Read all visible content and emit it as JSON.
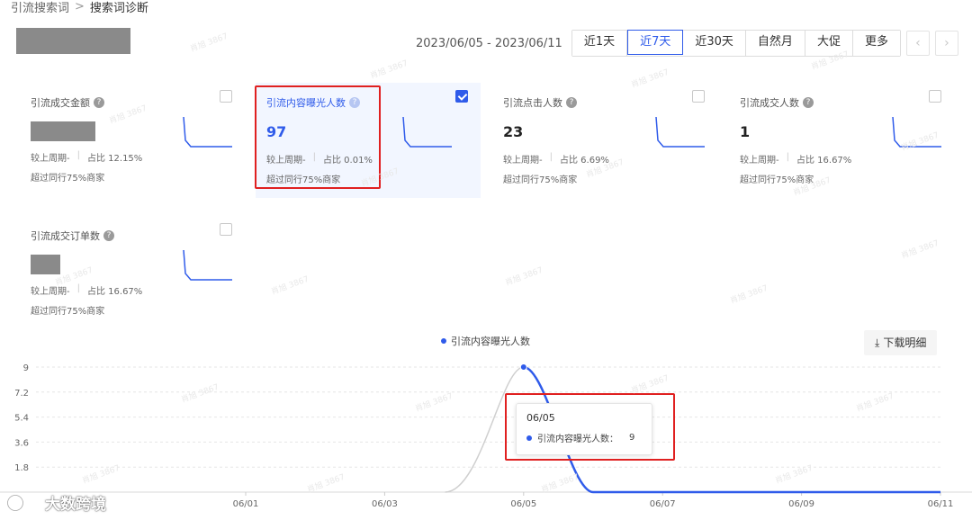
{
  "breadcrumb": {
    "parent": "引流搜索词",
    "sep": ">",
    "current": "搜索词诊断"
  },
  "date_range": "2023/06/05 - 2023/06/11",
  "period_buttons": [
    {
      "label": "近1天",
      "active": false
    },
    {
      "label": "近7天",
      "active": true
    },
    {
      "label": "近30天",
      "active": false
    },
    {
      "label": "自然月",
      "active": false
    },
    {
      "label": "大促",
      "active": false
    },
    {
      "label": "更多",
      "active": false
    }
  ],
  "nav": {
    "prev": "‹",
    "next": "›"
  },
  "metrics": [
    {
      "title": "引流成交金额",
      "value": "",
      "compare": "较上周期-",
      "share": "占比 12.15%",
      "rank": "超过同行75%商家",
      "checked": false,
      "spark": "drop"
    },
    {
      "title": "引流内容曝光人数",
      "value": "97",
      "compare": "较上周期-",
      "share": "占比 0.01%",
      "rank": "超过同行75%商家",
      "checked": true,
      "spark": "drop"
    },
    {
      "title": "引流点击人数",
      "value": "23",
      "compare": "较上周期-",
      "share": "占比 6.69%",
      "rank": "超过同行75%商家",
      "checked": false,
      "spark": "drop"
    },
    {
      "title": "引流成交人数",
      "value": "1",
      "compare": "较上周期-",
      "share": "占比 16.67%",
      "rank": "超过同行75%商家",
      "checked": false,
      "spark": "drop"
    },
    {
      "title": "引流成交订单数",
      "value": "",
      "compare": "较上周期-",
      "share": "占比 16.67%",
      "rank": "超过同行75%商家",
      "checked": false,
      "spark": "drop"
    }
  ],
  "download_label": "下载明细",
  "chart_data": {
    "type": "line",
    "series": [
      {
        "name": "引流内容曝光人数",
        "color": "#2f5bea",
        "points": [
          [
            "06/05",
            9
          ],
          [
            "06/06",
            0
          ],
          [
            "06/07",
            0
          ],
          [
            "06/08",
            0
          ],
          [
            "06/09",
            0
          ],
          [
            "06/10",
            0
          ],
          [
            "06/11",
            0
          ]
        ]
      },
      {
        "name": "",
        "color": "#cfcfcf",
        "points": [
          [
            "06/04",
            0
          ],
          [
            "06/05",
            9
          ]
        ]
      }
    ],
    "x_ticks": [
      "06/01",
      "06/03",
      "06/05",
      "06/07",
      "06/09",
      "06/11"
    ],
    "y_ticks": [
      9,
      7.2,
      5.4,
      3.6,
      1.8
    ],
    "ylim": [
      0,
      9
    ],
    "grid": true,
    "legend": "top-center"
  },
  "tooltip": {
    "date": "06/05",
    "label": "引流内容曝光人数：",
    "value": "9"
  },
  "logo_text": "大数跨境",
  "watermark": "肖旭 3867"
}
